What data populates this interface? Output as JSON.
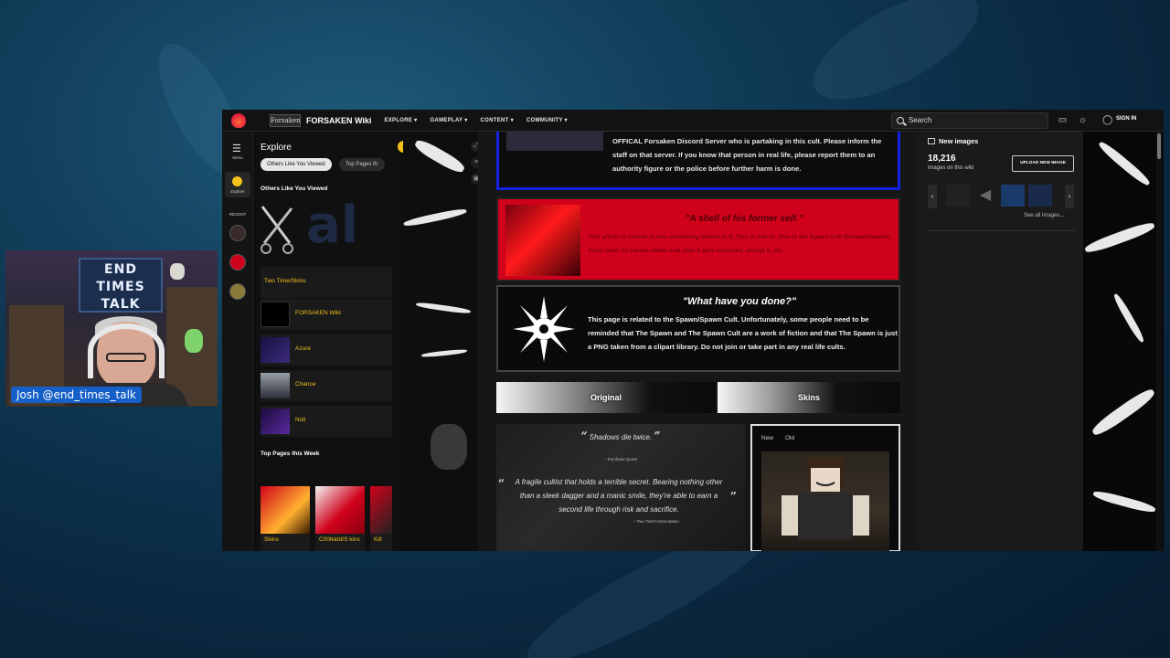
{
  "webcam": {
    "name_tag": "Josh @end_times_talk",
    "banner": "END TIMES TALK"
  },
  "browser": {
    "wiki_logo": "Forsaken",
    "wiki_name": "FORSAKEN Wiki",
    "nav": [
      "EXPLORE",
      "GAMEPLAY",
      "CONTENT",
      "COMMUNITY"
    ],
    "search_placeholder": "Search",
    "sign_in": "SIGN IN"
  },
  "rail": {
    "menu_label": "Menu",
    "explore_label": "Explore",
    "recent_label": "RECENT"
  },
  "explore_panel": {
    "title": "Explore",
    "pill_active": "Others Like You Viewed",
    "pill_inactive": "Top Pages th",
    "section1": "Others Like You Viewed",
    "items": [
      "Two Time/Skins",
      "FORSAKEN Wiki",
      "Azure",
      "Chance",
      "Noli"
    ],
    "section2": "Top Pages this Week",
    "top_pages": [
      "Skins",
      "C00lkidd/S kins",
      "Kill"
    ]
  },
  "article": {
    "blue_box_text": "OFFICAL Forsaken Discord Server who is partaking in this cult. Please inform the staff on that server. If you know that person in real life, please report them to an authority figure or the police before further harm is done.",
    "red_box_heading": "\"A shell of his former self.\"",
    "red_box_text": "This article is locked or has something locked to it. This is due to: Due to the Spawn Cult Drama/Situation. Sorry lads! So please either wait until it gets unlocked, accept it, etc.",
    "dark_box_heading": "\"What have you done?\"",
    "dark_box_text": "This page is related to the Spawn/Spawn Cult. Unfortunately, some people need to be reminded that The Spawn and The Spawn Cult are a work of fiction and that The Spawn is just a PNG taken from a clipart library. Do not join or take part in any real life cults.",
    "tabs": [
      "Original",
      "Skins"
    ],
    "quote1": "Shadows die twice.",
    "quote1_cite": "– Purchase Quote",
    "quote2": "A fragile cultist that holds a terrible secret. Bearing nothing other than a sleek dagger and a manic smile, they're able to earn a second life through risk and sacrifice.",
    "quote2_cite": "– Two Time's Description",
    "infobox_tabs": [
      "New",
      "Old"
    ]
  },
  "right_sidebar": {
    "title": "New images",
    "count": "18,216",
    "sub": "images on this wiki",
    "upload": "UPLOAD NEW IMAGE",
    "see_all": "See all images..."
  },
  "colors": {
    "accent": "#f2c21b",
    "alert_red": "#d0021b",
    "border_blue": "#1620e0",
    "name_tag": "#1560c8"
  }
}
